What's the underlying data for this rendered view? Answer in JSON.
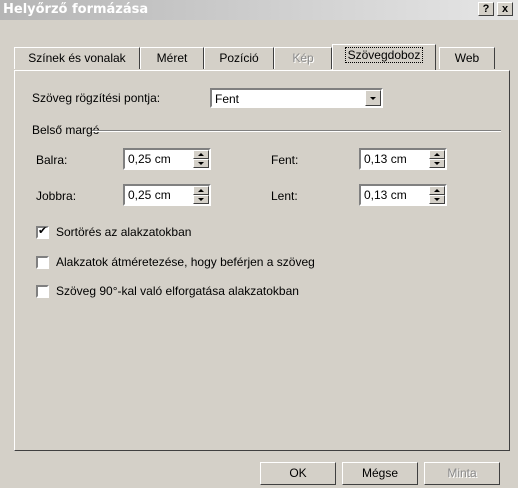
{
  "window": {
    "title": "Helyőrző formázása",
    "help_label": "?",
    "close_label": "x"
  },
  "tabs": [
    {
      "label": "Színek és vonalak",
      "state": "normal"
    },
    {
      "label": "Méret",
      "state": "normal"
    },
    {
      "label": "Pozíció",
      "state": "normal"
    },
    {
      "label": "Kép",
      "state": "disabled"
    },
    {
      "label": "Szövegdoboz",
      "state": "active"
    },
    {
      "label": "Web",
      "state": "normal"
    }
  ],
  "anchor": {
    "label": "Szöveg rögzítési pontja:",
    "value": "Fent"
  },
  "internal_margin": {
    "group_label": "Belső margó",
    "left": {
      "label": "Balra:",
      "value": "0,25 cm"
    },
    "right": {
      "label": "Jobbra:",
      "value": "0,25 cm"
    },
    "top": {
      "label": "Fent:",
      "value": "0,13 cm"
    },
    "bottom": {
      "label": "Lent:",
      "value": "0,13 cm"
    }
  },
  "options": [
    {
      "label": "Sortörés az alakzatokban",
      "checked": true
    },
    {
      "label": "Alakzatok átméretezése, hogy beférjen a szöveg",
      "checked": false
    },
    {
      "label": "Szöveg 90°-kal való elforgatása alakzatokban",
      "checked": false
    }
  ],
  "buttons": {
    "ok": "OK",
    "cancel": "Mégse",
    "preview": "Minta"
  },
  "colors": {
    "face": "#d4d0c8",
    "title_gradient_start": "#b5b5b5",
    "title_gradient_end": "#e6e6e6"
  }
}
